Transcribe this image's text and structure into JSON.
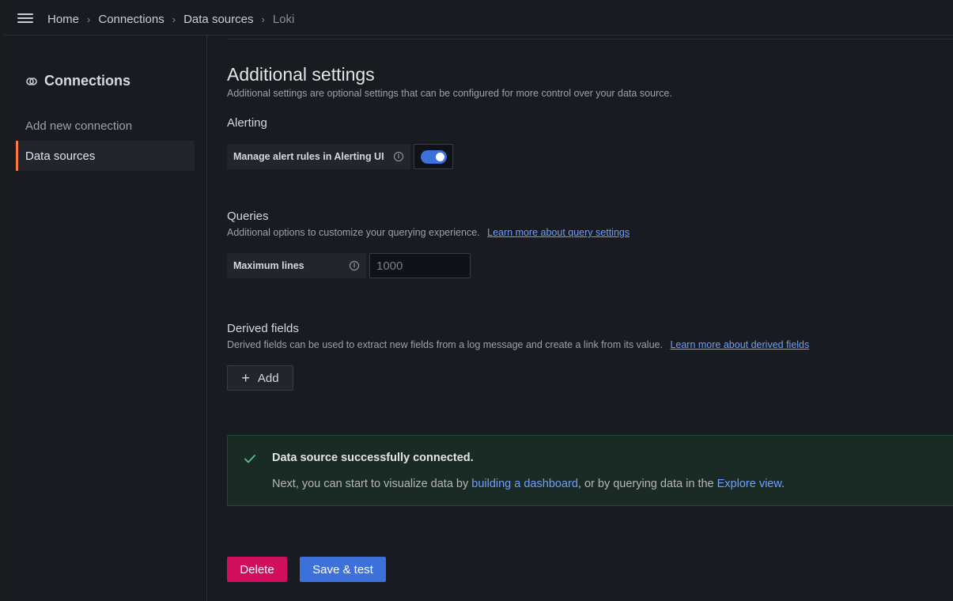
{
  "breadcrumb": {
    "items": [
      "Home",
      "Connections",
      "Data sources"
    ],
    "current": "Loki",
    "separator": "›"
  },
  "sidebar": {
    "title": "Connections",
    "icon": "connections-icon",
    "items": [
      {
        "label": "Add new connection",
        "active": false
      },
      {
        "label": "Data sources",
        "active": true
      }
    ]
  },
  "main": {
    "title": "Additional settings",
    "description": "Additional settings are optional settings that can be configured for more control over your data source.",
    "alerting": {
      "title": "Alerting",
      "label": "Manage alert rules in Alerting UI",
      "enabled": true
    },
    "queries": {
      "title": "Queries",
      "description": "Additional options to customize your querying experience.",
      "link": "Learn more about query settings",
      "max_lines_label": "Maximum lines",
      "max_lines_placeholder": "1000",
      "max_lines_value": ""
    },
    "derived": {
      "title": "Derived fields",
      "description": "Derived fields can be used to extract new fields from a log message and create a link from its value.",
      "link": "Learn more about derived fields",
      "add_label": "Add"
    },
    "alert_box": {
      "title": "Data source successfully connected.",
      "text_before": "Next, you can start to visualize data by ",
      "link1": "building a dashboard",
      "text_middle": ", or by querying data in the ",
      "link2": "Explore view",
      "text_after": "."
    },
    "buttons": {
      "delete": "Delete",
      "save": "Save & test"
    }
  },
  "colors": {
    "accent": "#3d71d9",
    "danger": "#d10e5c",
    "success": "#5ec188",
    "active_marker": "#ff7941",
    "link": "#6e9fff"
  }
}
